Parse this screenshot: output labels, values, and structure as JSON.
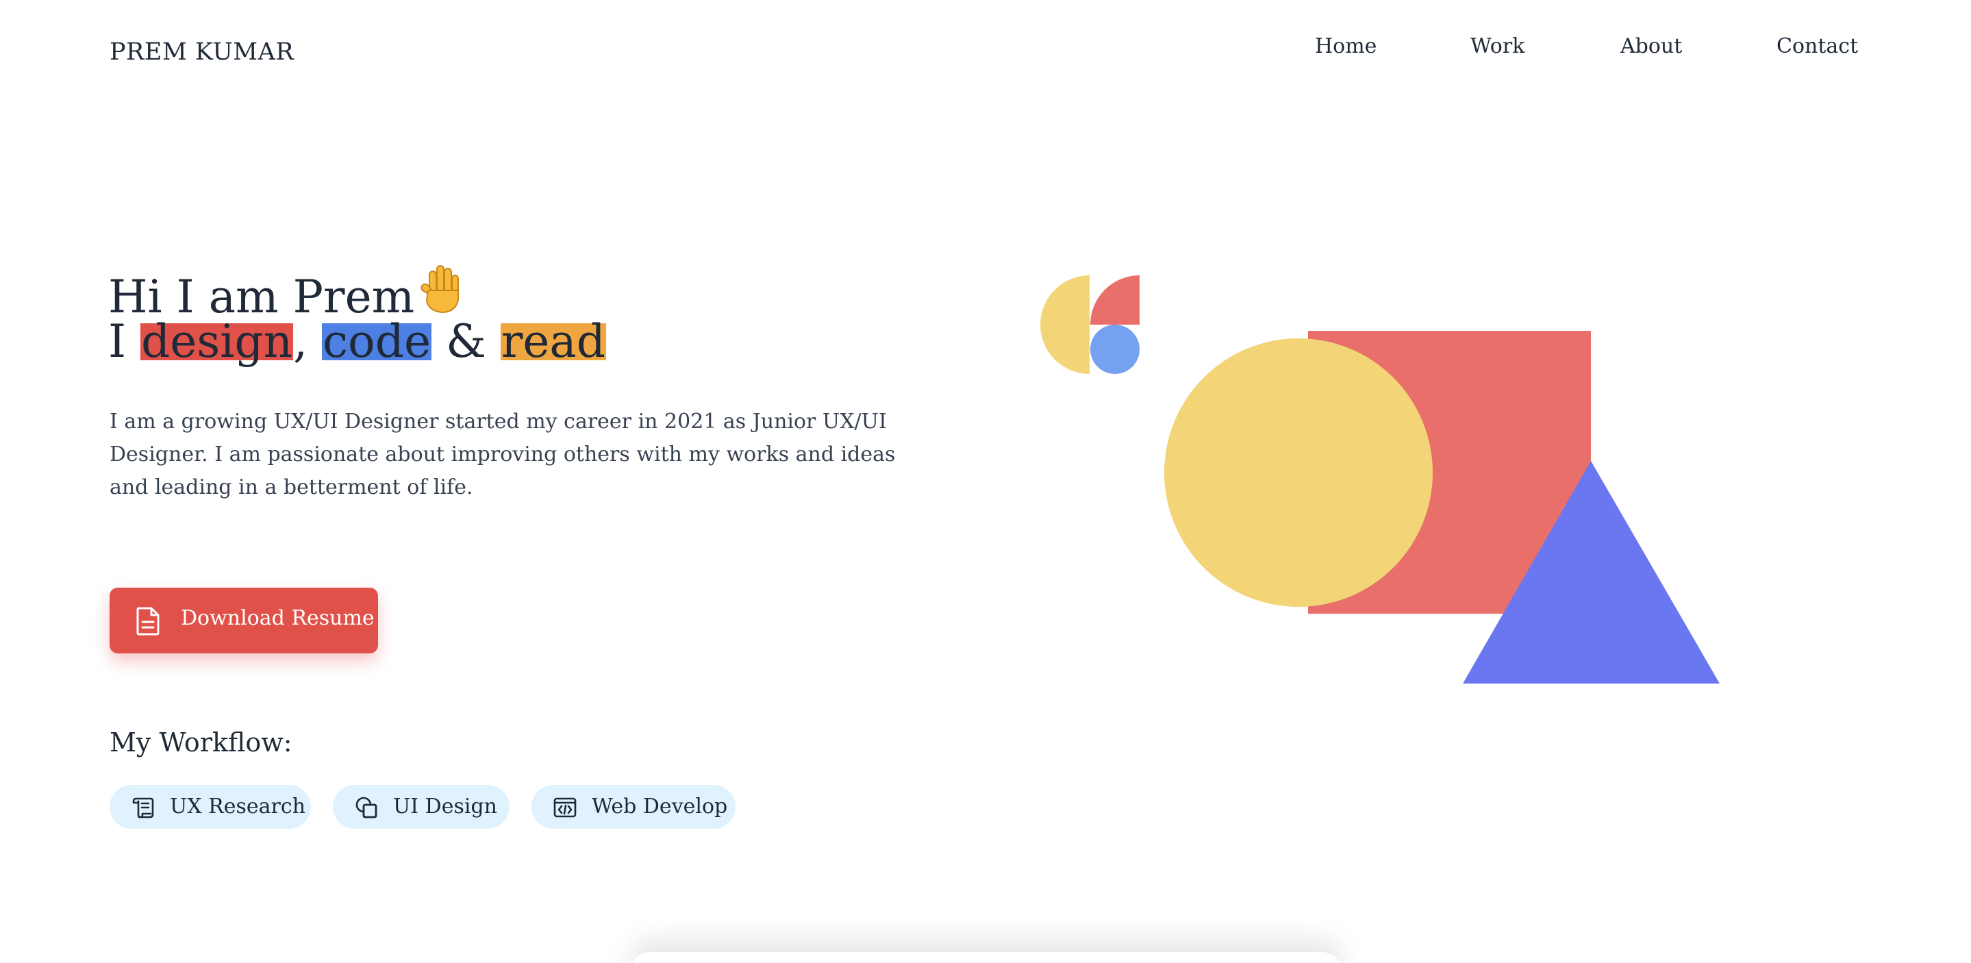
{
  "header": {
    "brand": "PREM KUMAR",
    "nav": [
      {
        "label": "Home"
      },
      {
        "label": "Work"
      },
      {
        "label": "About"
      },
      {
        "label": "Contact"
      }
    ]
  },
  "hero": {
    "greeting": "Hi I am Prem",
    "greeting_icon": "waving-hand-icon",
    "tagline_prefix": "I ",
    "tagline_word1": "design",
    "tagline_sep1": ", ",
    "tagline_word2": "code",
    "tagline_sep2": " & ",
    "tagline_word3": "read",
    "intro": "I am a growing UX/UI Designer started my career in 2021 as Junior UX/UI Designer. I am passionate about improving others with my works and ideas and leading in a betterment of life."
  },
  "download": {
    "label": "Download Resume",
    "icon": "document-icon"
  },
  "workflow": {
    "title": "My Workflow:",
    "items": [
      {
        "label": "UX Research",
        "icon": "scroll-icon"
      },
      {
        "label": "UI Design",
        "icon": "shapes-icon"
      },
      {
        "label": "Web Develop",
        "icon": "code-window-icon"
      }
    ]
  },
  "colors": {
    "accent_red": "#e05149",
    "accent_blue": "#4e7fe2",
    "accent_orange": "#f0a640",
    "shape_yellow": "#f3d577",
    "shape_coral": "#e86f6a",
    "shape_blue_light": "#74a2f0",
    "shape_indigo": "#6a77f0",
    "chip_bg": "#e0f2fe"
  }
}
